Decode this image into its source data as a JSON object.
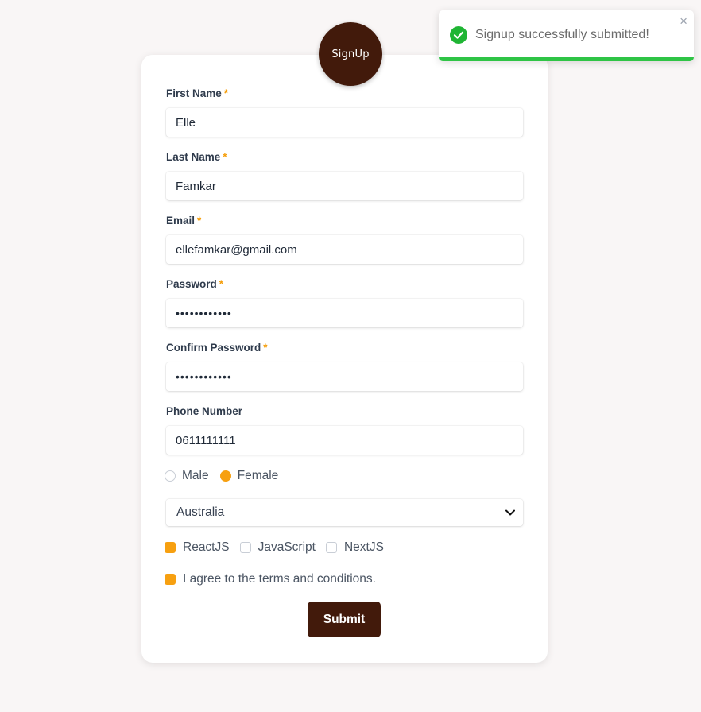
{
  "logo": {
    "text": "SignUp"
  },
  "form": {
    "first_name": {
      "label": "First Name",
      "required": "*",
      "value": "Elle"
    },
    "last_name": {
      "label": "Last Name",
      "required": "*",
      "value": "Famkar"
    },
    "email": {
      "label": "Email",
      "required": "*",
      "value": "ellefamkar@gmail.com"
    },
    "password": {
      "label": "Password",
      "required": "*",
      "value": "••••••••••••"
    },
    "confirm_password": {
      "label": "Confirm Password",
      "required": "*",
      "value": "••••••••••••"
    },
    "phone": {
      "label": "Phone Number",
      "value": "0611111111"
    },
    "gender": {
      "options": [
        {
          "label": "Male",
          "checked": false
        },
        {
          "label": "Female",
          "checked": true
        }
      ]
    },
    "country": {
      "selected": "Australia"
    },
    "skills": [
      {
        "label": "ReactJS",
        "checked": true
      },
      {
        "label": "JavaScript",
        "checked": false
      },
      {
        "label": "NextJS",
        "checked": false
      }
    ],
    "terms": {
      "label": "I agree to the terms and conditions.",
      "checked": true
    },
    "submit_label": "Submit"
  },
  "toast": {
    "message": "Signup successfully submitted!",
    "close": "×",
    "icon": "check-circle-icon",
    "progress": 1.0
  },
  "colors": {
    "brand": "#421a0b",
    "accent": "#f7a010",
    "success": "#2fc446",
    "background": "#f9f6f6"
  }
}
